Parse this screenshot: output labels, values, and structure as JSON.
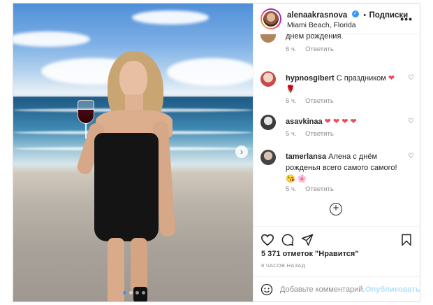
{
  "post": {
    "header": {
      "username": "alenaakrasnova",
      "separator": "•",
      "follow_label": "Подписки",
      "location": "Miami Beach, Florida",
      "more_label": "•••"
    },
    "comments": [
      {
        "user": "",
        "text": "днём рождения.",
        "time": "6 ч.",
        "reply": "Ответить"
      },
      {
        "user": "hypnosgibert",
        "text": "С праздником",
        "emoji": "❤ 🌹",
        "time": "6 ч.",
        "reply": "Ответить"
      },
      {
        "user": "asavkinaa",
        "text": "",
        "emoji": "❤ ❤ ❤ ❤",
        "time": "5 ч.",
        "reply": "Ответить"
      },
      {
        "user": "tamerlansa",
        "text": "Алена с днём рожденья всего самого самого!",
        "emoji": "😘 🌸",
        "time": "5 ч.",
        "reply": "Ответить"
      }
    ],
    "likes": "5 371 отметок \"Нравится\"",
    "posted": "8 ЧАСОВ НАЗАД",
    "comment_input": {
      "placeholder": "Добавьте комментарий..."
    },
    "publish_label": "Опубликовать",
    "carousel": {
      "slides": 4,
      "active_index": 0
    }
  }
}
